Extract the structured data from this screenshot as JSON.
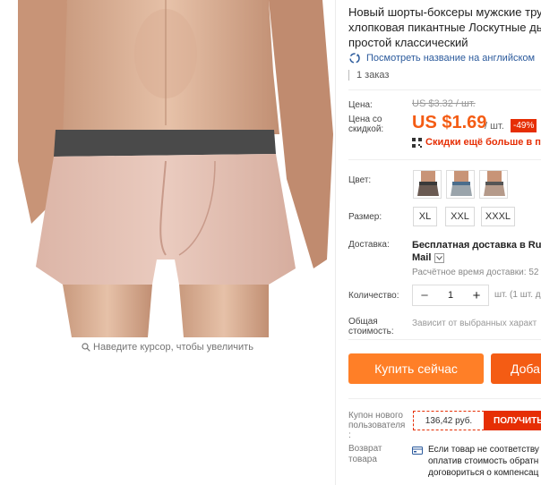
{
  "image": {
    "zoom_hint": "Наведите курсор, чтобы увеличить"
  },
  "product": {
    "title_lines": [
      "Новый шорты-боксеры мужские тру",
      "хлопковая пикантные Лоскутные дь",
      "простой классический"
    ],
    "translate_link": "Посмотреть название на английском",
    "orders": "1 заказ"
  },
  "price": {
    "label": "Цена:",
    "old": "US $3.32 / шт.",
    "discount_label_lines": [
      "Цена со",
      "скидкой:"
    ],
    "current": "US $1.69",
    "unit": "/ шт.",
    "discount": "-49%",
    "promo": "Скидки ещё больше в прил"
  },
  "color": {
    "label": "Цвет:",
    "swatches": [
      "brown-gray",
      "gray-blue",
      "beige-gray"
    ]
  },
  "size": {
    "label": "Размер:",
    "options": [
      "XL",
      "XXL",
      "XXXL"
    ]
  },
  "shipping": {
    "label": "Доставка:",
    "title": "Бесплатная доставка в Russ",
    "carrier": "Mail",
    "time": "Расчётное время доставки: 52"
  },
  "quantity": {
    "label": "Количество:",
    "value": "1",
    "minus": "−",
    "plus": "+",
    "note": "шт. (1 шт. д"
  },
  "total": {
    "label_lines": [
      "Общая",
      "стоимость:"
    ],
    "text": "Зависит от выбранных характ"
  },
  "buttons": {
    "buy": "Купить сейчас",
    "cart": "Доба"
  },
  "coupon": {
    "label_lines": [
      "Купон нового",
      "пользователя",
      ":"
    ],
    "amount": "136,42 руб.",
    "get": "ПОЛУЧИТЬ"
  },
  "returns": {
    "label_lines": [
      "Возврат",
      "товара"
    ],
    "text_lines": [
      "Если товар не соответству",
      "оплатив стоимость обратн",
      "договориться о компенсац"
    ]
  },
  "colors": {
    "accent": "#f45c14",
    "red": "#e62e04",
    "orange": "#ff7f27",
    "link": "#2b5a9c"
  }
}
